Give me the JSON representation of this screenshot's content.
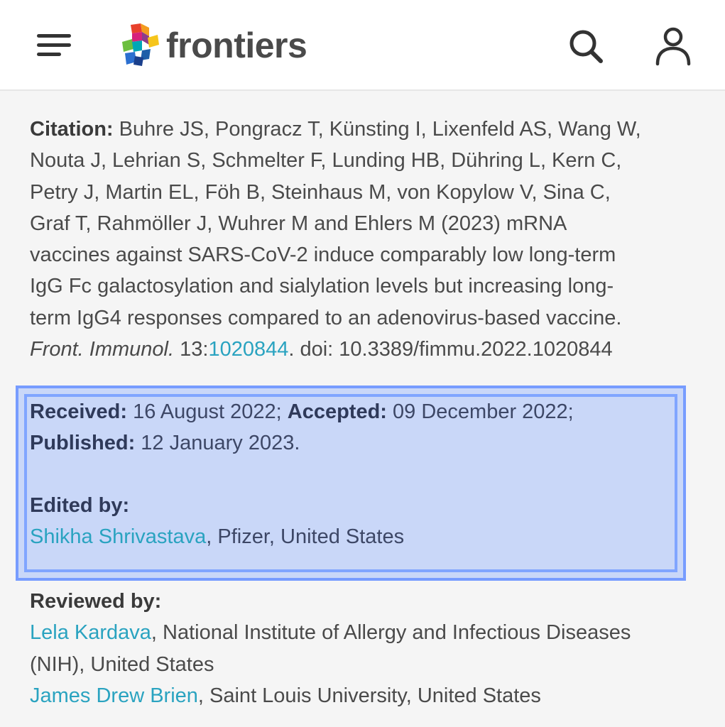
{
  "header": {
    "menu_icon": "hamburger-menu-icon",
    "logo_text": "frontiers",
    "search_icon": "search-icon",
    "user_icon": "user-icon"
  },
  "citation": {
    "label": "Citation:",
    "lines": [
      " Buhre JS, Pongracz T, Künsting I, Lixenfeld AS, Wang W,",
      "Nouta J, Lehrian S, Schmelter F, Lunding HB, Dühring L, Kern C,",
      "Petry J, Martin EL, Föh B, Steinhaus M, von Kopylow V, Sina C,",
      "Graf T, Rahmöller J, Wuhrer M and Ehlers M (2023) mRNA",
      "vaccines against SARS-CoV-2 induce comparably low long-term",
      "IgG Fc galactosylation and sialylation levels but increasing long-",
      "term IgG4 responses compared to an adenovirus-based vaccine."
    ],
    "journal": "Front. Immunol.",
    "volume": " 13:",
    "article_id": "1020844",
    "doi": ". doi: 10.3389/fimmu.2022.1020844"
  },
  "dates": {
    "received_label": "Received:",
    "received_value": " 16 August 2022; ",
    "accepted_label": "Accepted:",
    "accepted_value": " 09 December 2022;",
    "published_label": "Published:",
    "published_value": " 12 January 2023."
  },
  "edited": {
    "label": "Edited by:",
    "editor_name": "Shikha Shrivastava",
    "editor_affiliation": ", Pfizer, United States"
  },
  "reviewed": {
    "label": "Reviewed by:",
    "reviewers": [
      {
        "name": "Lela Kardava",
        "affiliation_line1": ", National Institute of Allergy and Infectious Diseases",
        "affiliation_line2": "(NIH), United States"
      },
      {
        "name": "James Drew Brien",
        "affiliation_line1": ", Saint Louis University, United States"
      }
    ]
  },
  "colors": {
    "link": "#2aa3c0",
    "highlight": "#7aa0ff",
    "text": "#4a4a4a"
  }
}
